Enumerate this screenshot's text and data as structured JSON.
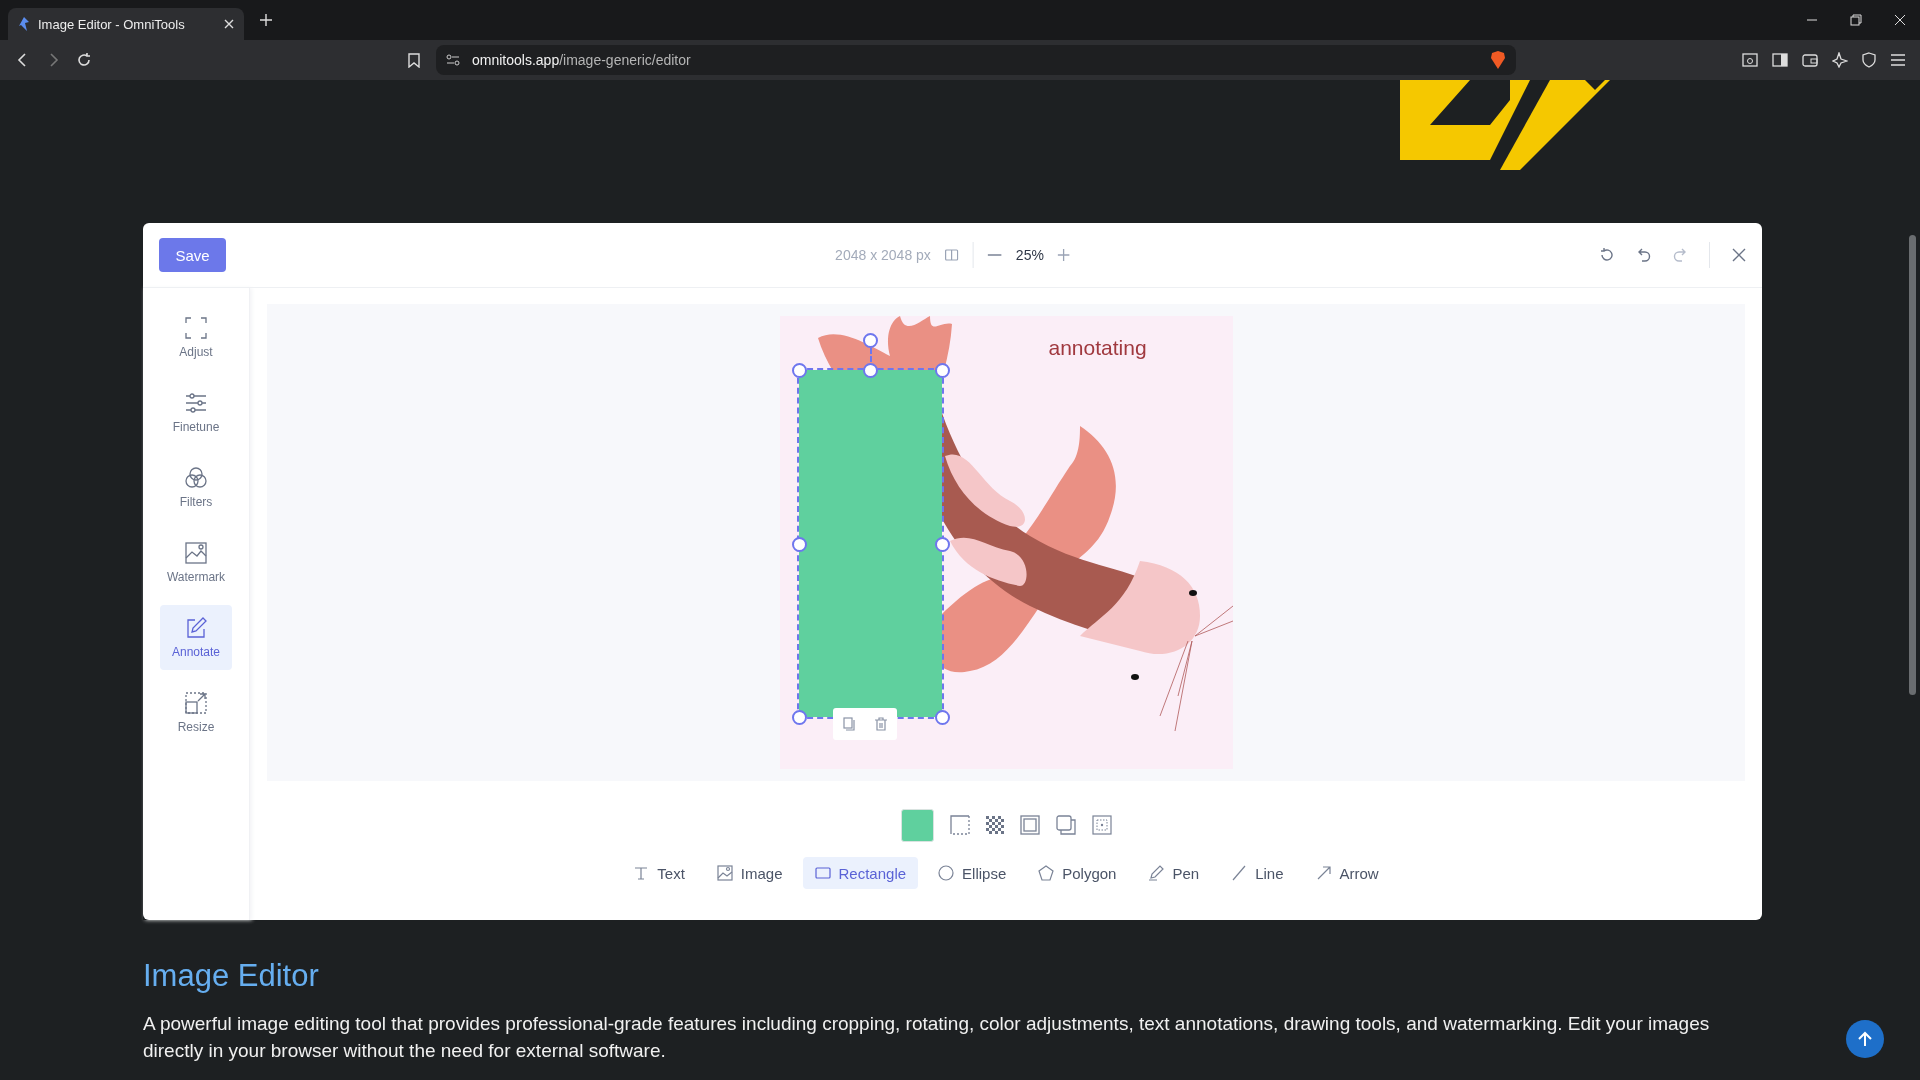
{
  "browser": {
    "tab_title": "Image Editor - OmniTools",
    "url_host": "omnitools.app",
    "url_path": "/image-generic/editor"
  },
  "editor": {
    "save_button": "Save",
    "dimensions": "2048 x 2048 px",
    "zoom": "25%",
    "sidebar": [
      {
        "label": "Adjust",
        "selected": false
      },
      {
        "label": "Finetune",
        "selected": false
      },
      {
        "label": "Filters",
        "selected": false
      },
      {
        "label": "Watermark",
        "selected": false
      },
      {
        "label": "Annotate",
        "selected": true
      },
      {
        "label": "Resize",
        "selected": false
      }
    ],
    "annotations": [
      {
        "text": "annotating"
      }
    ],
    "tools": [
      {
        "label": "Text",
        "selected": false
      },
      {
        "label": "Image",
        "selected": false
      },
      {
        "label": "Rectangle",
        "selected": true
      },
      {
        "label": "Ellipse",
        "selected": false
      },
      {
        "label": "Polygon",
        "selected": false
      },
      {
        "label": "Pen",
        "selected": false
      },
      {
        "label": "Line",
        "selected": false
      },
      {
        "label": "Arrow",
        "selected": false
      }
    ]
  },
  "page": {
    "heading": "Image Editor",
    "description": "A powerful image editing tool that provides professional-grade features including cropping, rotating, color adjustments, text annotations, drawing tools, and watermarking. Edit your images directly in your browser without the need for external software."
  }
}
